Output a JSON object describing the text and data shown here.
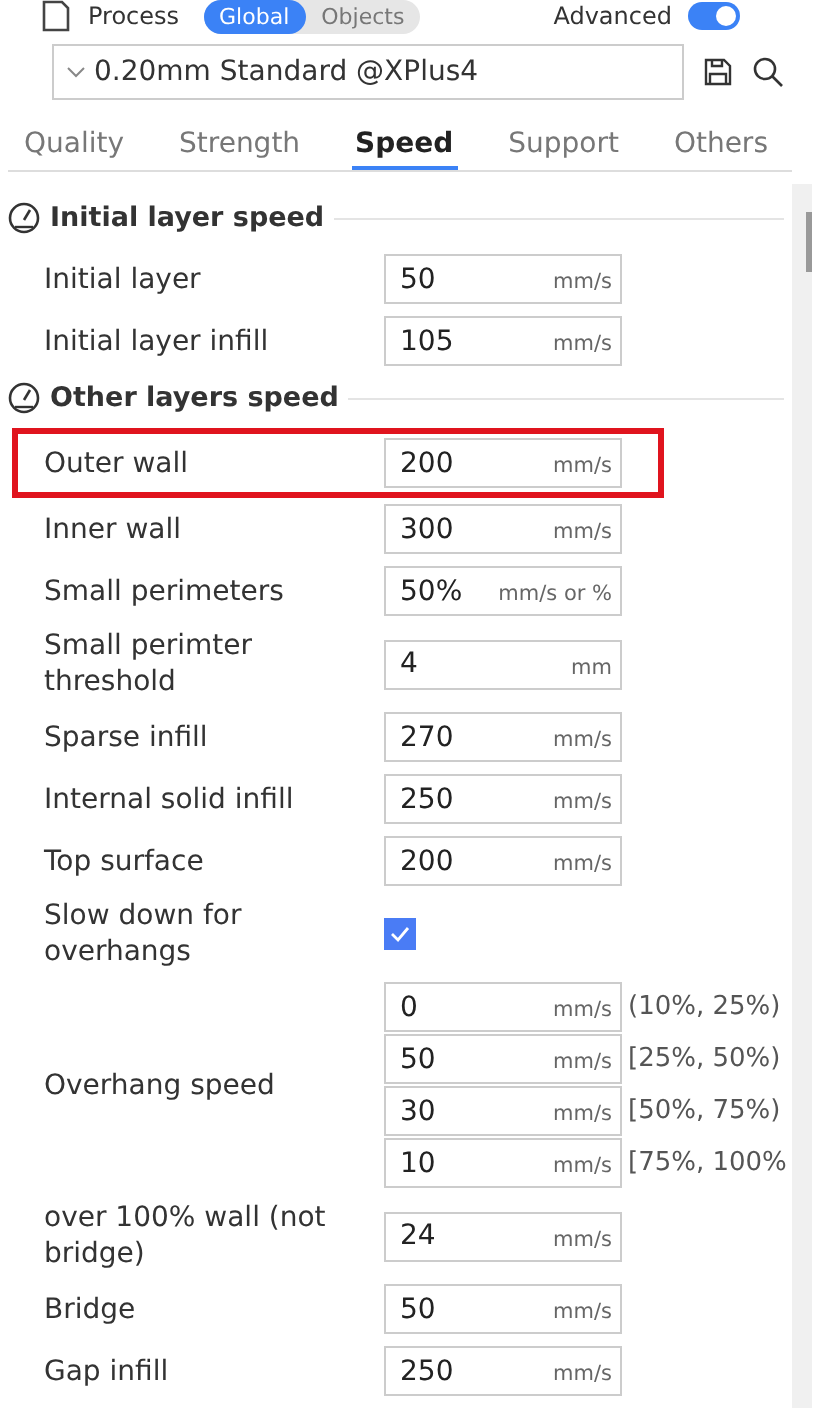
{
  "top_bar": {
    "title": "Process",
    "scope_tabs": [
      {
        "label": "Global",
        "selected": true
      },
      {
        "label": "Objects",
        "selected": false
      }
    ],
    "advanced": {
      "label": "Advanced",
      "on": true
    }
  },
  "preset": {
    "value": "0.20mm Standard @XPlus4"
  },
  "tabs": [
    {
      "label": "Quality",
      "selected": false
    },
    {
      "label": "Strength",
      "selected": false
    },
    {
      "label": "Speed",
      "selected": true
    },
    {
      "label": "Support",
      "selected": false
    },
    {
      "label": "Others",
      "selected": false
    }
  ],
  "sections": [
    {
      "title": "Initial layer speed",
      "rows": [
        {
          "kind": "field",
          "label": "Initial layer",
          "highlighted": false,
          "fields": [
            {
              "value": "50",
              "unit": "mm/s"
            }
          ]
        },
        {
          "kind": "field",
          "label": "Initial layer infill",
          "highlighted": false,
          "fields": [
            {
              "value": "105",
              "unit": "mm/s"
            }
          ]
        }
      ]
    },
    {
      "title": "Other layers speed",
      "rows": [
        {
          "kind": "field",
          "label": "Outer wall",
          "highlighted": true,
          "fields": [
            {
              "value": "200",
              "unit": "mm/s"
            }
          ]
        },
        {
          "kind": "field",
          "label": "Inner wall",
          "highlighted": false,
          "fields": [
            {
              "value": "300",
              "unit": "mm/s"
            }
          ]
        },
        {
          "kind": "field",
          "label": "Small perimeters",
          "highlighted": false,
          "fields": [
            {
              "value": "50%",
              "unit": "mm/s or %"
            }
          ]
        },
        {
          "kind": "field",
          "label": "Small perimter threshold",
          "highlighted": false,
          "fields": [
            {
              "value": "4",
              "unit": "mm"
            }
          ]
        },
        {
          "kind": "field",
          "label": "Sparse infill",
          "highlighted": false,
          "fields": [
            {
              "value": "270",
              "unit": "mm/s"
            }
          ]
        },
        {
          "kind": "field",
          "label": "Internal solid infill",
          "highlighted": false,
          "fields": [
            {
              "value": "250",
              "unit": "mm/s"
            }
          ]
        },
        {
          "kind": "field",
          "label": "Top surface",
          "highlighted": false,
          "fields": [
            {
              "value": "200",
              "unit": "mm/s"
            }
          ]
        },
        {
          "kind": "checkbox",
          "label": "Slow down for overhangs",
          "highlighted": false,
          "checked": true
        },
        {
          "kind": "field",
          "label": "Overhang speed",
          "highlighted": false,
          "fields": [
            {
              "value": "0",
              "unit": "mm/s",
              "range": "(10%, 25%)"
            },
            {
              "value": "50",
              "unit": "mm/s",
              "range": "[25%, 50%)"
            },
            {
              "value": "30",
              "unit": "mm/s",
              "range": "[50%, 75%)"
            },
            {
              "value": "10",
              "unit": "mm/s",
              "range": "[75%, 100%"
            }
          ]
        },
        {
          "kind": "field",
          "label": "over 100% wall (not bridge)",
          "highlighted": false,
          "fields": [
            {
              "value": "24",
              "unit": "mm/s"
            }
          ]
        },
        {
          "kind": "field",
          "label": "Bridge",
          "highlighted": false,
          "fields": [
            {
              "value": "50",
              "unit": "mm/s"
            }
          ]
        },
        {
          "kind": "field",
          "label": "Gap infill",
          "highlighted": false,
          "fields": [
            {
              "value": "250",
              "unit": "mm/s"
            }
          ]
        }
      ]
    }
  ]
}
